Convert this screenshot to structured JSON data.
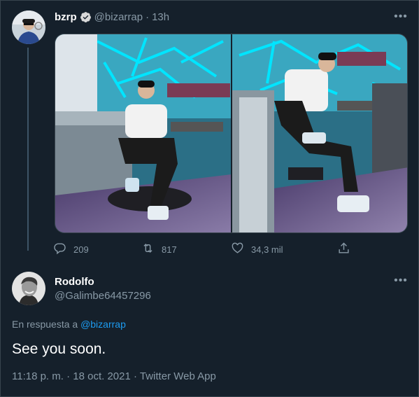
{
  "original_tweet": {
    "display_name": "bzrp",
    "handle": "@bizarrap",
    "separator": "·",
    "time_ago": "13h",
    "more_label": "•••",
    "stats": {
      "replies": "209",
      "retweets": "817",
      "likes": "34,3 mil"
    }
  },
  "reply": {
    "display_name": "Rodolfo",
    "handle": "@Galimbe64457296",
    "more_label": "•••",
    "in_reply_prefix": "En respuesta a",
    "in_reply_handle": "@bizarrap",
    "text": "See you soon.",
    "timestamp": "11:18 p. m. · 18 oct. 2021 · Twitter Web App"
  },
  "colors": {
    "background": "#15202b",
    "accent": "#1d9bf0",
    "muted": "#8899a6",
    "studio_neon": "#00e5ff"
  },
  "icons": [
    "verified-badge-icon",
    "reply-icon",
    "retweet-icon",
    "like-icon",
    "share-icon"
  ]
}
